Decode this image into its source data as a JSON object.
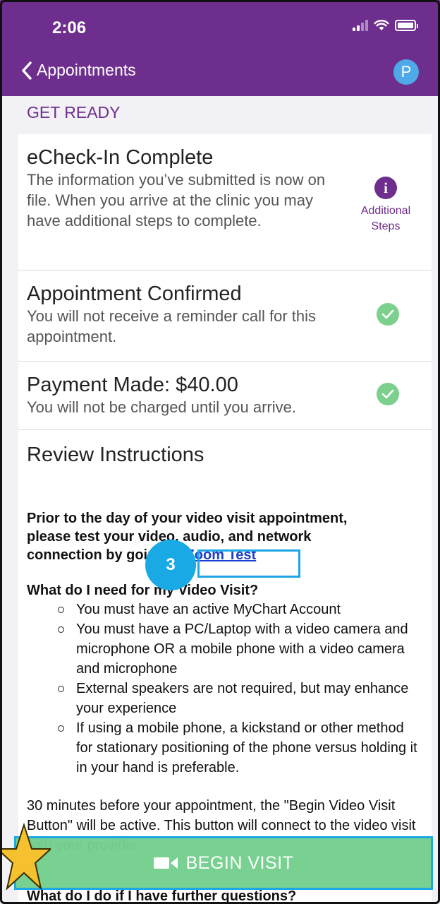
{
  "status": {
    "time": "2:06"
  },
  "nav": {
    "back_label": "Appointments",
    "avatar_initial": "P"
  },
  "section": {
    "title": "GET READY"
  },
  "cards": {
    "echeckin": {
      "title": "eCheck-In Complete",
      "body": "The information you’ve submitted is now on file. When you arrive at the clinic you may have additional steps to complete.",
      "action_label_1": "Additional",
      "action_label_2": "Steps"
    },
    "confirmed": {
      "title": "Appointment Confirmed",
      "body": "You will not receive a reminder call for this appointment."
    },
    "payment": {
      "title": "Payment Made: $40.00",
      "body": "You will not be charged until you arrive."
    },
    "review": {
      "title": "Review Instructions",
      "intro_1": "Prior to the day of your video visit appointment,",
      "intro_2": "please test your video, audio, and network",
      "intro_3": "connection by going to",
      "link": "Zoom Test",
      "question_1": "What do I need for my Video Visit?",
      "items": [
        "You must have an active MyChart Account",
        "You must have a PC/Laptop with a video camera and microphone OR a mobile phone with a video camera and microphone",
        "External speakers are not required, but may enhance your experience",
        "If using a mobile phone, a kickstand or other method for stationary positioning of the phone versus holding it in your hand is preferable."
      ],
      "para": "30 minutes before your appointment, the \"Begin Video Visit Button\" will be active. This button will connect to the video visit with your provider.",
      "question_2": "What do I do if I have further questions?"
    }
  },
  "overlay": {
    "step_badge": "3"
  },
  "action": {
    "begin_label": "BEGIN VISIT"
  },
  "colors": {
    "brand": "#6e2e8d",
    "success": "#7cd08e",
    "highlight": "#1da7e6"
  }
}
